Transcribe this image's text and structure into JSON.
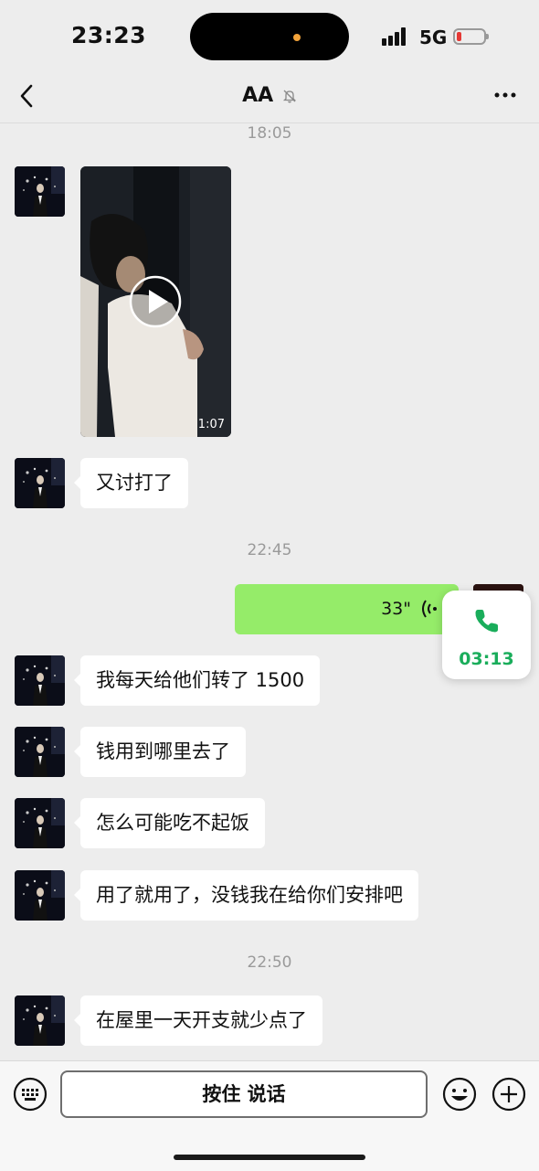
{
  "status_bar": {
    "time": "23:23",
    "network": "5G"
  },
  "header": {
    "title": "AA"
  },
  "messages": [
    {
      "type": "timestamp",
      "text": "18:05"
    },
    {
      "type": "video",
      "sender": "other",
      "duration": "1:07"
    },
    {
      "type": "text",
      "sender": "other",
      "text": "又讨打了"
    },
    {
      "type": "timestamp",
      "text": "22:45"
    },
    {
      "type": "voice",
      "sender": "self",
      "length": "33\""
    },
    {
      "type": "text",
      "sender": "other",
      "text": "我每天给他们转了 1500"
    },
    {
      "type": "text",
      "sender": "other",
      "text": "钱用到哪里去了"
    },
    {
      "type": "text",
      "sender": "other",
      "text": "怎么可能吃不起饭"
    },
    {
      "type": "text",
      "sender": "other",
      "text": "用了就用了，没钱我在给你们安排吧"
    },
    {
      "type": "timestamp",
      "text": "22:50"
    },
    {
      "type": "text",
      "sender": "other",
      "text": "在屋里一天开支就少点了"
    }
  ],
  "call_float": {
    "duration": "03:13",
    "icon": "phone-icon",
    "color": "#1aad5b"
  },
  "input_bar": {
    "talk_label": "按住 说话"
  },
  "colors": {
    "self_bubble": "#95ec69",
    "other_bubble": "#ffffff",
    "background": "#ededed"
  }
}
